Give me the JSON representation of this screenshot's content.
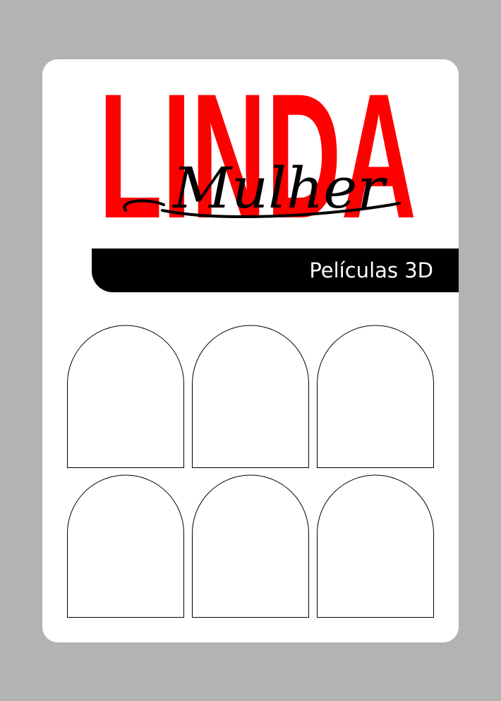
{
  "brand": {
    "title": "LINDA",
    "script": "Mulher",
    "title_color": "#ff0000",
    "script_color": "#000000"
  },
  "banner": {
    "label": "Películas 3D",
    "background": "#000000",
    "text_color": "#ffffff"
  },
  "nail_slots": {
    "rows": 2,
    "columns": 3,
    "shape": "arch"
  },
  "colors": {
    "page_background": "#b3b3b3",
    "card_background": "#ffffff"
  }
}
